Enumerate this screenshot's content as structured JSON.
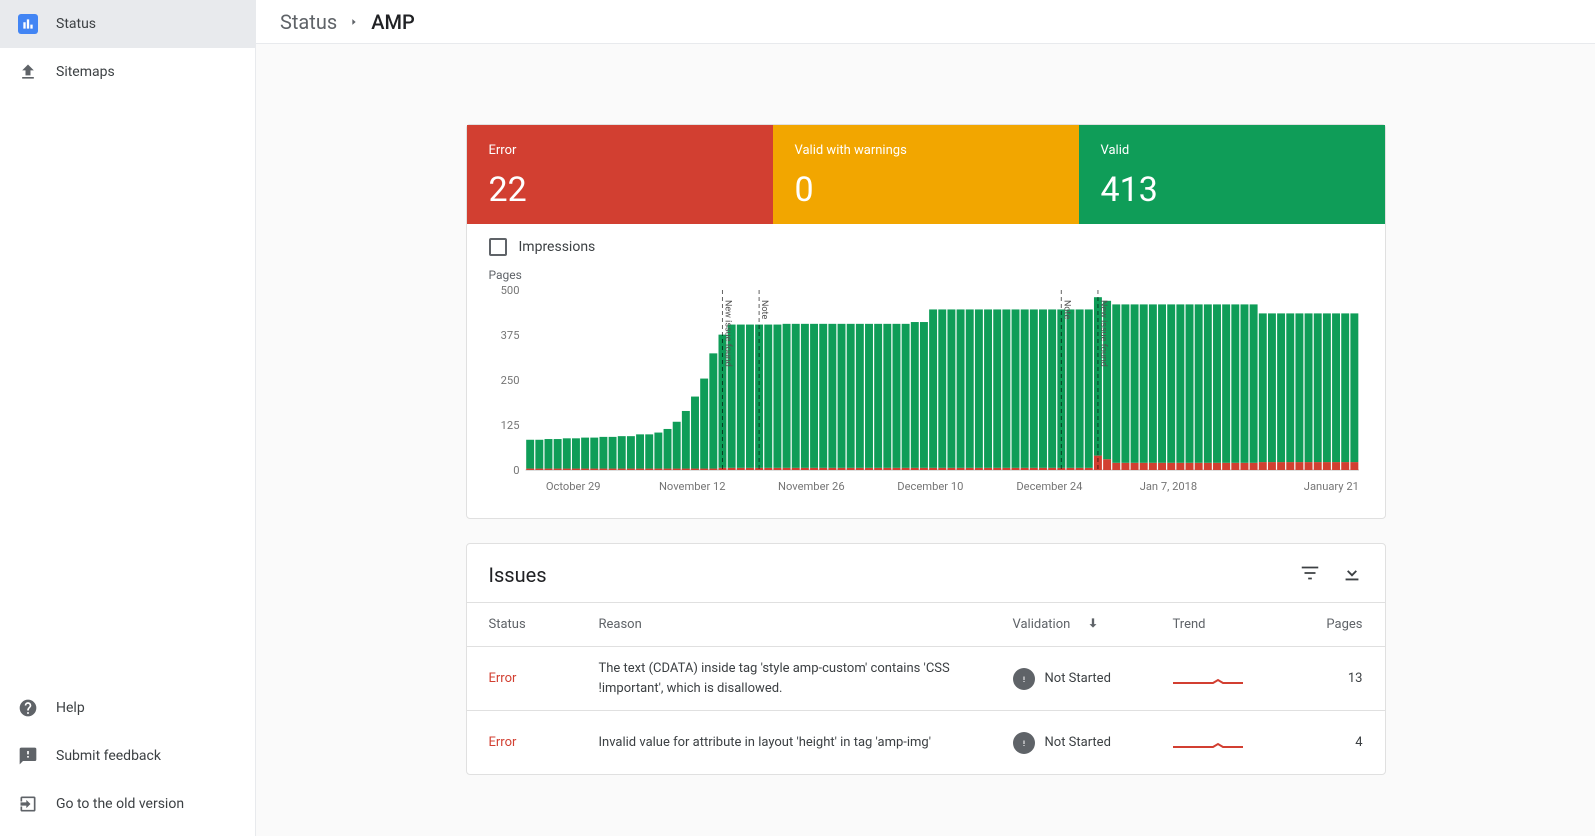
{
  "sidebar": {
    "items": [
      {
        "label": "Status",
        "icon": "bar-chart"
      },
      {
        "label": "Sitemaps",
        "icon": "upload"
      }
    ],
    "bottom": [
      {
        "label": "Help",
        "icon": "help"
      },
      {
        "label": "Submit feedback",
        "icon": "feedback"
      },
      {
        "label": "Go to the old version",
        "icon": "exit"
      }
    ]
  },
  "breadcrumb": {
    "root": "Status",
    "current": "AMP"
  },
  "summary": {
    "error": {
      "label": "Error",
      "value": "22"
    },
    "warning": {
      "label": "Valid with warnings",
      "value": "0"
    },
    "valid": {
      "label": "Valid",
      "value": "413"
    }
  },
  "impressions_label": "Impressions",
  "chart": {
    "axis_title": "Pages",
    "y_ticks": [
      "500",
      "375",
      "250",
      "125",
      "0"
    ],
    "x_ticks": [
      "October 29",
      "November 12",
      "November 26",
      "December 10",
      "December 24",
      "Jan 7, 2018",
      "January 21"
    ],
    "annotations": [
      "New issue found",
      "Note",
      "Note",
      "New issue found"
    ]
  },
  "issues": {
    "title": "Issues",
    "columns": {
      "status": "Status",
      "reason": "Reason",
      "validation": "Validation",
      "trend": "Trend",
      "pages": "Pages"
    },
    "rows": [
      {
        "status": "Error",
        "reason": "The text (CDATA) inside tag 'style amp-custom' contains 'CSS !important', which is disallowed.",
        "validation": "Not Started",
        "pages": "13"
      },
      {
        "status": "Error",
        "reason": "Invalid value for attribute in layout 'height' in tag 'amp-img'",
        "validation": "Not Started",
        "pages": "4"
      }
    ]
  },
  "chart_data": {
    "type": "bar",
    "title": "Pages",
    "ylim": [
      0,
      500
    ],
    "x_axis_dates": {
      "start": "2017-10-22",
      "end": "2018-01-21"
    },
    "x_ticks": [
      "October 29",
      "November 12",
      "November 26",
      "December 10",
      "December 24",
      "Jan 7, 2018",
      "January 21"
    ],
    "series": [
      {
        "name": "Valid",
        "color": "#0f9d58",
        "values": [
          80,
          80,
          82,
          82,
          84,
          84,
          86,
          86,
          88,
          88,
          90,
          90,
          95,
          95,
          100,
          110,
          130,
          160,
          200,
          250,
          320,
          370,
          398,
          398,
          398,
          398,
          398,
          398,
          400,
          400,
          400,
          400,
          400,
          400,
          400,
          400,
          400,
          400,
          400,
          400,
          400,
          400,
          405,
          405,
          440,
          440,
          440,
          440,
          440,
          440,
          440,
          440,
          440,
          440,
          440,
          440,
          440,
          440,
          440,
          440,
          440,
          440,
          440,
          440,
          440,
          440,
          440,
          440,
          440,
          440,
          440,
          440,
          440,
          440,
          440,
          440,
          440,
          440,
          440,
          440,
          413,
          413,
          413,
          413,
          413,
          413,
          413,
          413,
          413,
          413,
          413
        ]
      },
      {
        "name": "Error",
        "color": "#d23f31",
        "values": [
          4,
          4,
          4,
          4,
          4,
          4,
          4,
          4,
          4,
          4,
          4,
          4,
          4,
          4,
          4,
          4,
          4,
          4,
          4,
          4,
          4,
          6,
          6,
          6,
          6,
          6,
          6,
          6,
          6,
          6,
          6,
          6,
          6,
          6,
          6,
          6,
          6,
          6,
          6,
          6,
          6,
          6,
          6,
          6,
          6,
          6,
          6,
          6,
          6,
          6,
          6,
          6,
          6,
          6,
          6,
          6,
          6,
          6,
          6,
          6,
          6,
          6,
          40,
          30,
          20,
          20,
          20,
          20,
          20,
          20,
          20,
          20,
          20,
          20,
          20,
          20,
          20,
          20,
          20,
          20,
          22,
          22,
          22,
          22,
          22,
          22,
          22,
          22,
          22,
          22,
          22
        ]
      }
    ],
    "markers": [
      {
        "label": "New issue found",
        "approx_index": 21
      },
      {
        "label": "Note",
        "approx_index": 25
      },
      {
        "label": "Note",
        "approx_index": 58
      },
      {
        "label": "New issue found",
        "approx_index": 62
      }
    ]
  }
}
